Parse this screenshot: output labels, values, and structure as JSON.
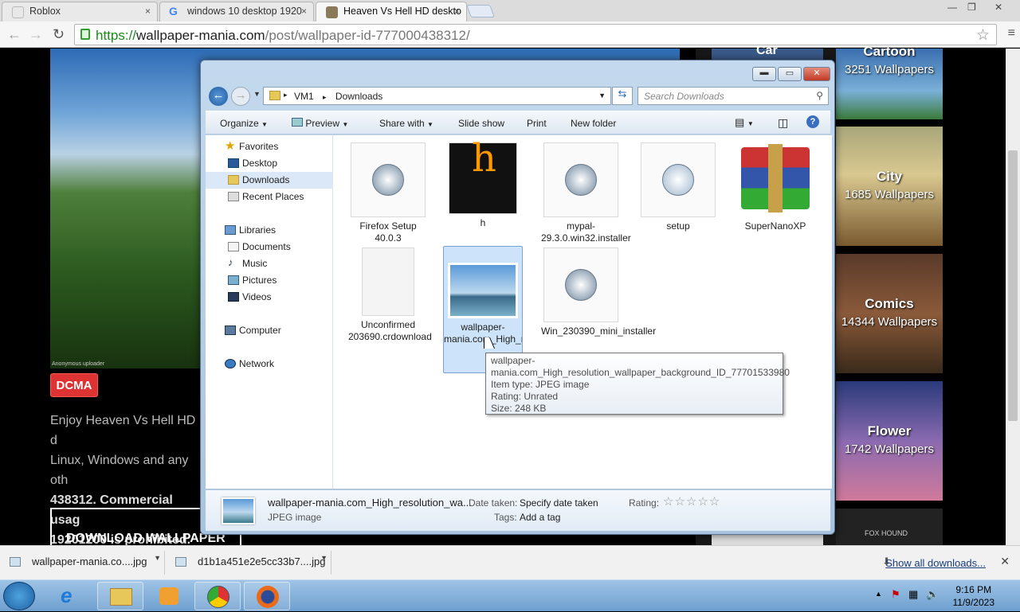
{
  "browser": {
    "tabs": [
      {
        "label": "Roblox",
        "close": "×"
      },
      {
        "label": "windows 10 desktop 1920",
        "close": "×"
      },
      {
        "label": "Heaven Vs Hell HD deskto",
        "close": "×"
      }
    ],
    "url_https": "https://",
    "url_host": "wallpaper-mania.com",
    "url_path": "/post/wallpaper-id-777000438312/",
    "win_controls": [
      "—",
      "❐",
      "✕"
    ]
  },
  "page": {
    "dcma": "DCMA",
    "desc_lines": [
      "Enjoy Heaven Vs Hell HD d",
      "Linux, Windows and any oth"
    ],
    "desc_bold_1": "438312",
    "desc_bold_1b": ". Commercial usag",
    "desc_bold_2": "19201200 is prohibited.",
    "download_wallpaper": "DOWNLOAD WALLPAPER",
    "image_credit": "Anonymous uploader",
    "categories": [
      {
        "title": "Cartoon",
        "count": "3251 Wallpapers"
      },
      {
        "title": "City",
        "count": "1685 Wallpapers"
      },
      {
        "title": "Comics",
        "count": "14344 Wallpapers"
      },
      {
        "title": "Flower",
        "count": "1742 Wallpapers"
      }
    ],
    "car_label": "Car",
    "fox_label": "FOX HOUND"
  },
  "explorer": {
    "breadcrumb": [
      "VM1",
      "Downloads"
    ],
    "search_placeholder": "Search Downloads",
    "commands": [
      "Organize",
      "Preview",
      "Share with",
      "Slide show",
      "Print",
      "New folder"
    ],
    "nav": {
      "favorites": "Favorites",
      "desktop": "Desktop",
      "downloads": "Downloads",
      "recent": "Recent Places",
      "libraries": "Libraries",
      "documents": "Documents",
      "music": "Music",
      "pictures": "Pictures",
      "videos": "Videos",
      "computer": "Computer",
      "network": "Network"
    },
    "files": [
      {
        "name": "Firefox Setup 40.0.3"
      },
      {
        "name": "h"
      },
      {
        "name": "mypal-29.3.0.win32.installer"
      },
      {
        "name": "setup"
      },
      {
        "name": "SuperNanoXP"
      },
      {
        "name": "Unconfirmed 203690.crdownload"
      },
      {
        "name": "wallpaper-mania.com_High_resolution_wallpaper_background"
      },
      {
        "name": "Win_230390_mini_installer"
      }
    ],
    "tooltip": {
      "line1": "wallpaper-",
      "line2": "mania.com_High_resolution_wallpaper_background_ID_77701533980",
      "type": "Item type: JPEG image",
      "rating": "Rating: Unrated",
      "size": "Size: 248 KB"
    },
    "details": {
      "filename": "wallpaper-mania.com_High_resolution_wa...",
      "filetype": "JPEG image",
      "date_label": "Date taken:",
      "date_value": "Specify date taken",
      "tags_label": "Tags:",
      "tags_value": "Add a tag",
      "rating_label": "Rating:",
      "stars": "☆☆☆☆☆"
    }
  },
  "downloads_bar": {
    "items": [
      "wallpaper-mania.co....jpg",
      "d1b1a451e2e5cc33b7....jpg"
    ],
    "show_all": "Show all downloads...",
    "close": "✕"
  },
  "taskbar": {
    "time": "9:16 PM",
    "date": "11/9/2023"
  }
}
